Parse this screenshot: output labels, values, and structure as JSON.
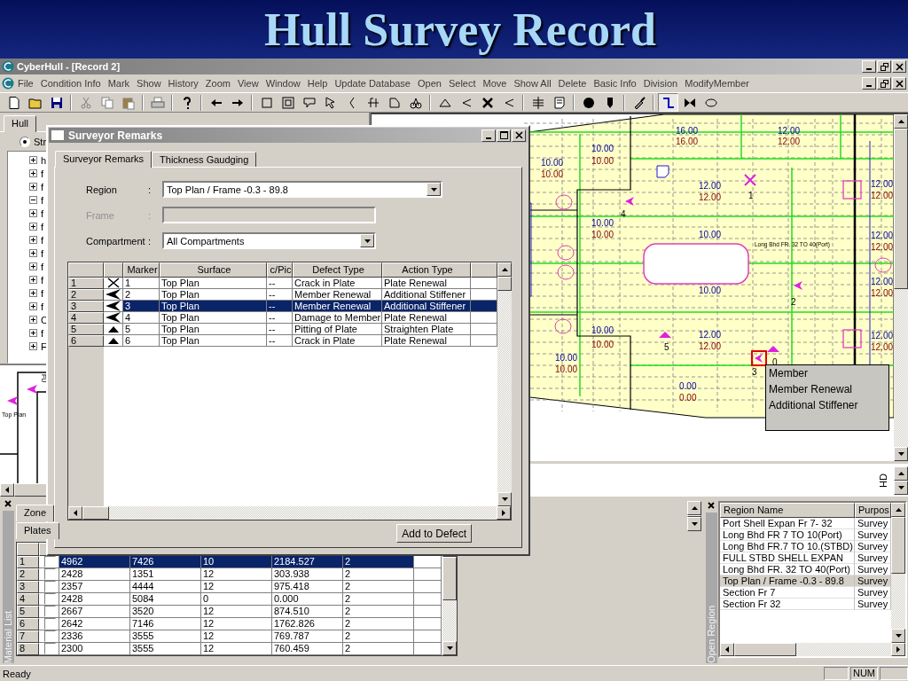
{
  "banner": {
    "title": "Hull Survey Record"
  },
  "window": {
    "title": "CyberHull - [Record 2]"
  },
  "menu": [
    "File",
    "Condition Info",
    "Mark",
    "Show",
    "History",
    "Zoom",
    "View",
    "Window",
    "Help",
    "Update Database",
    "Open",
    "Select",
    "Move",
    "Show All",
    "Delete",
    "Basic Info",
    "Division",
    "ModifyMember"
  ],
  "toolbar": [
    {
      "selected": false
    },
    {
      "selected": false
    },
    {
      "selected": false
    },
    {
      "selected": false
    },
    {
      "selected": false
    },
    {
      "selected": false
    },
    {
      "selected": false
    },
    {
      "selected": false
    },
    {
      "selected": false
    },
    {
      "selected": false
    },
    {
      "selected": false
    },
    {
      "selected": false
    },
    {
      "selected": false
    },
    {
      "selected": false
    },
    {
      "selected": false
    },
    {
      "selected": false
    },
    {
      "selected": false
    },
    {
      "selected": false
    },
    {
      "selected": false
    },
    {
      "selected": false
    },
    {
      "selected": false
    },
    {
      "selected": false
    },
    {
      "selected": false
    },
    {
      "selected": false
    },
    {
      "selected": false
    },
    {
      "selected": false
    },
    {
      "selected": false
    },
    {
      "selected": true
    },
    {
      "selected": false
    },
    {
      "selected": false
    }
  ],
  "hull_panel": {
    "tabs": [
      {
        "label": "Hull",
        "selected": true
      }
    ],
    "radio": {
      "label": "Str",
      "selected": true
    },
    "tree": [
      {
        "label": "h",
        "expanded": false
      },
      {
        "label": "f",
        "expanded": false
      },
      {
        "label": "f",
        "expanded": false
      },
      {
        "label": "f",
        "expanded": true
      },
      {
        "label": "f",
        "expanded": false
      },
      {
        "label": "f",
        "expanded": false
      },
      {
        "label": "f",
        "expanded": false
      },
      {
        "label": "f",
        "expanded": false
      },
      {
        "label": "f",
        "expanded": false
      },
      {
        "label": "f",
        "expanded": false
      },
      {
        "label": "f",
        "expanded": false
      },
      {
        "label": "f",
        "expanded": false
      },
      {
        "label": "C",
        "expanded": false
      },
      {
        "label": "f",
        "expanded": false
      },
      {
        "label": "F",
        "expanded": false
      }
    ]
  },
  "mini_map": {
    "labels": [
      {
        "text": "FU",
        "kind": "vertical"
      },
      {
        "text": "Top Plan",
        "kind": "region"
      }
    ]
  },
  "map": {
    "labels": [
      {
        "text": "16.00",
        "kind": "design"
      },
      {
        "text": "12.00",
        "kind": "design"
      },
      {
        "text": "16.00",
        "kind": "measured"
      },
      {
        "text": "12.00",
        "kind": "measured"
      },
      {
        "text": "10.00",
        "kind": "design"
      },
      {
        "text": "10.00",
        "kind": "design"
      },
      {
        "text": "10.00",
        "kind": "measured"
      },
      {
        "text": "10.00",
        "kind": "measured"
      },
      {
        "text": "12.00",
        "kind": "design"
      },
      {
        "text": "12.00",
        "kind": "design"
      },
      {
        "text": "12.00",
        "kind": "measured"
      },
      {
        "text": "1",
        "kind": "marker"
      },
      {
        "text": "12.00",
        "kind": "measured"
      },
      {
        "text": "4",
        "kind": "marker"
      },
      {
        "text": "10.00",
        "kind": "design"
      },
      {
        "text": "10.00",
        "kind": "measured"
      },
      {
        "text": "10.00",
        "kind": "design"
      },
      {
        "text": "12.00",
        "kind": "design"
      },
      {
        "text": "Long Bhd FR. 32 TO 40(Port)",
        "kind": "region"
      },
      {
        "text": "12.00",
        "kind": "measured"
      },
      {
        "text": "12.00",
        "kind": "design"
      },
      {
        "text": "10.00",
        "kind": "design"
      },
      {
        "text": "12.00",
        "kind": "measured"
      },
      {
        "text": "2",
        "kind": "marker"
      },
      {
        "text": "10.00",
        "kind": "design"
      },
      {
        "text": "12.00",
        "kind": "design"
      },
      {
        "text": "12.00",
        "kind": "design"
      },
      {
        "text": "10.00",
        "kind": "measured"
      },
      {
        "text": "5",
        "kind": "marker"
      },
      {
        "text": "12.00",
        "kind": "measured"
      },
      {
        "text": "12.00",
        "kind": "measured"
      },
      {
        "text": "10.00",
        "kind": "design"
      },
      {
        "text": "0",
        "kind": "marker"
      },
      {
        "text": "10.00",
        "kind": "measured"
      },
      {
        "text": "3",
        "kind": "marker"
      },
      {
        "text": "0.00",
        "kind": "design"
      },
      {
        "text": "0.00",
        "kind": "measured"
      }
    ],
    "tooltip": [
      "Member",
      "Member Renewal",
      "Additional Stiffener"
    ],
    "footer_label": "HD"
  },
  "dialog": {
    "title": "Surveyor Remarks",
    "tabs": [
      {
        "label": "Surveyor Remarks",
        "selected": true
      },
      {
        "label": "Thickness Gaudging",
        "selected": false
      }
    ],
    "fields": [
      {
        "label": "Region",
        "colon": ":",
        "kind": "combo",
        "value": "Top Plan / Frame -0.3 - 89.8",
        "disabled": false
      },
      {
        "label": "Frame",
        "colon": ":",
        "kind": "text",
        "disabled": true
      },
      {
        "label": "Compartment",
        "colon": ":",
        "kind": "combo",
        "value": "All Compartments",
        "disabled": false
      }
    ],
    "grid": {
      "columns": [
        "Marker",
        "Surface",
        "c/Pic",
        "Defect Type",
        "Action Type"
      ],
      "rows": [
        {
          "number": "1",
          "kind": "cross",
          "cells": [
            "1",
            "Top Plan",
            "--",
            "Crack in Plate",
            "Plate Renewal"
          ],
          "selected": false
        },
        {
          "number": "2",
          "kind": "arrow",
          "cells": [
            "2",
            "Top Plan",
            "--",
            "Member Renewal",
            "Additional Stiffener"
          ],
          "selected": false
        },
        {
          "number": "3",
          "kind": "arrow",
          "cells": [
            "3",
            "Top Plan",
            "--",
            "Member Renewal",
            "Additional Stiffener"
          ],
          "selected": true
        },
        {
          "number": "4",
          "kind": "arrow",
          "cells": [
            "4",
            "Top Plan",
            "--",
            "Damage to Member",
            "Plate Renewal"
          ],
          "selected": false
        },
        {
          "number": "5",
          "kind": "triangle",
          "cells": [
            "5",
            "Top Plan",
            "--",
            "Pitting of Plate",
            "Straighten Plate"
          ],
          "selected": false
        },
        {
          "number": "6",
          "kind": "triangle",
          "cells": [
            "6",
            "Top Plan",
            "--",
            "Crack in Plate",
            "Plate Renewal"
          ],
          "selected": false
        }
      ]
    },
    "button": "Add to Defect"
  },
  "material_list": {
    "title": "Material List",
    "tabs": [
      {
        "label": "Zone",
        "selected": true
      }
    ],
    "subtabs": [
      {
        "label": "Plates",
        "selected": true
      }
    ],
    "rows": [
      {
        "number": "1",
        "checked": false,
        "selected": true,
        "cells": [
          "4962",
          "7426",
          "10",
          "2184.527",
          "2"
        ]
      },
      {
        "number": "2",
        "checked": false,
        "selected": false,
        "cells": [
          "2428",
          "1351",
          "12",
          "303.938",
          "2"
        ]
      },
      {
        "number": "3",
        "checked": false,
        "selected": false,
        "cells": [
          "2357",
          "4444",
          "12",
          "975.418",
          "2"
        ]
      },
      {
        "number": "4",
        "checked": false,
        "selected": false,
        "cells": [
          "2428",
          "5084",
          "0",
          "0.000",
          "2"
        ]
      },
      {
        "number": "5",
        "checked": false,
        "selected": false,
        "cells": [
          "2667",
          "3520",
          "12",
          "874.510",
          "2"
        ]
      },
      {
        "number": "6",
        "checked": false,
        "selected": false,
        "cells": [
          "2642",
          "7146",
          "12",
          "1762.826",
          "2"
        ]
      },
      {
        "number": "7",
        "checked": false,
        "selected": false,
        "cells": [
          "2336",
          "3555",
          "12",
          "769.787",
          "2"
        ]
      },
      {
        "number": "8",
        "checked": false,
        "selected": false,
        "cells": [
          "2300",
          "3555",
          "12",
          "760.459",
          "2"
        ]
      }
    ]
  },
  "open_region": {
    "title": "Open Region",
    "columns": [
      "Region Name",
      "Purpos"
    ],
    "rows": [
      {
        "cells": [
          "Port Shell Expan Fr 7- 32",
          "Survey"
        ],
        "selected": false
      },
      {
        "cells": [
          "Long Bhd FR 7 TO 10(Port)",
          "Survey"
        ],
        "selected": false
      },
      {
        "cells": [
          "Long Bhd FR.7 TO 10.(STBD)",
          "Survey"
        ],
        "selected": false
      },
      {
        "cells": [
          "FULL STBD SHELL EXPAN",
          "Survey"
        ],
        "selected": false
      },
      {
        "cells": [
          "Long Bhd FR. 32 TO 40(Port)",
          "Survey"
        ],
        "selected": false
      },
      {
        "cells": [
          "Top Plan / Frame -0.3 - 89.8",
          "Survey"
        ],
        "selected": true
      },
      {
        "cells": [
          "Section Fr 7",
          "Survey"
        ],
        "selected": false
      },
      {
        "cells": [
          "Section Fr 32",
          "Survey"
        ],
        "selected": false
      }
    ]
  },
  "status_bar": {
    "text": "Ready",
    "num": "NUM"
  }
}
